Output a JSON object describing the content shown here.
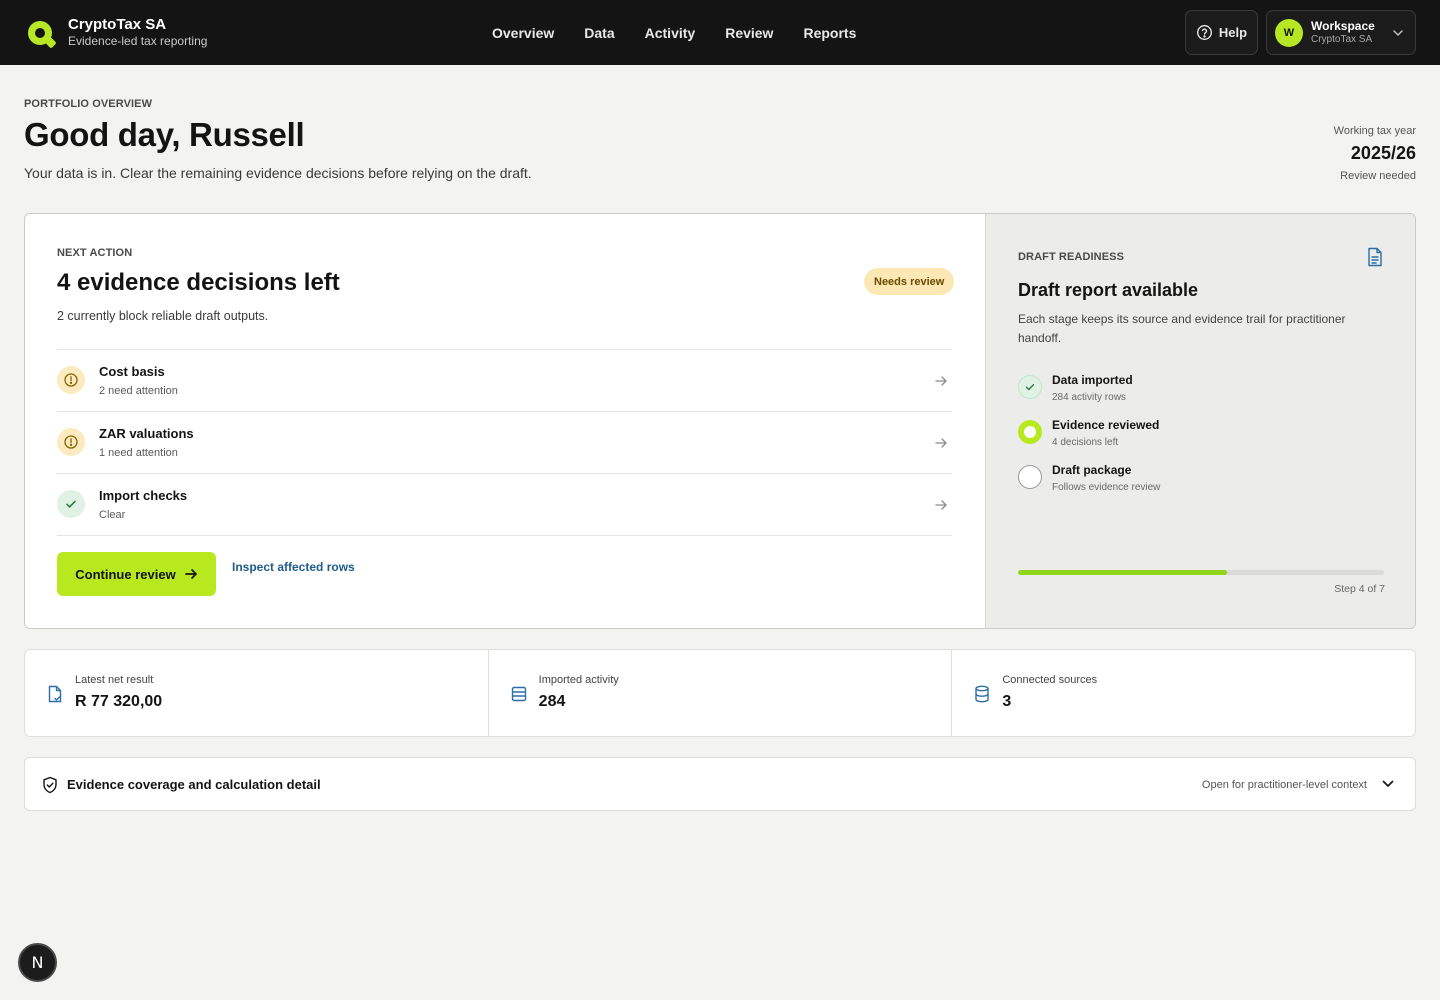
{
  "brand": {
    "name": "CryptoTax SA",
    "tagline": "Evidence-led tax reporting"
  },
  "nav": [
    "Overview",
    "Data",
    "Activity",
    "Review",
    "Reports"
  ],
  "header": {
    "help_label": "Help",
    "workspace": {
      "avatar": "W",
      "title": "Workspace",
      "subtitle": "CryptoTax SA"
    }
  },
  "page": {
    "eyebrow": "PORTFOLIO OVERVIEW",
    "greeting": "Good day, Russell",
    "subtitle": "Your data is in. Clear the remaining evidence decisions before relying on the draft.",
    "tax_year": {
      "label": "Working tax year",
      "value": "2025/26",
      "status": "Review needed"
    }
  },
  "next_action": {
    "eyebrow": "NEXT ACTION",
    "title": "4 evidence decisions left",
    "subtitle": "2 currently block reliable draft outputs.",
    "badge": "Needs review",
    "tasks": [
      {
        "name": "Cost basis",
        "status": "2 need attention",
        "state": "warning"
      },
      {
        "name": "ZAR valuations",
        "status": "1 need attention",
        "state": "warning"
      },
      {
        "name": "Import checks",
        "status": "Clear",
        "state": "ok"
      }
    ],
    "primary_label": "Continue review",
    "secondary_label": "Inspect affected rows"
  },
  "readiness": {
    "eyebrow": "DRAFT READINESS",
    "title": "Draft report available",
    "description": "Each stage keeps its source and evidence trail for practitioner handoff.",
    "stages": [
      {
        "name": "Data imported",
        "status": "284 activity rows",
        "state": "done"
      },
      {
        "name": "Evidence reviewed",
        "status": "4 decisions left",
        "state": "current"
      },
      {
        "name": "Draft package",
        "status": "Follows evidence review",
        "state": "todo"
      }
    ],
    "progress_fraction": 0.571,
    "step_label": "Step 4 of 7"
  },
  "stats": [
    {
      "label": "Latest net result",
      "value": "R 77 320,00",
      "icon": "document-icon"
    },
    {
      "label": "Imported activity",
      "value": "284",
      "icon": "list-icon"
    },
    {
      "label": "Connected sources",
      "value": "3",
      "icon": "database-icon"
    }
  ],
  "accordion": {
    "title": "Evidence coverage and calculation detail",
    "hint": "Open for practitioner-level context"
  },
  "fab_label": "N",
  "colors": {
    "accent": "#b8e81e",
    "header_bg": "#141414",
    "warning_bg": "#fcebc0",
    "link": "#1f5d8c"
  }
}
